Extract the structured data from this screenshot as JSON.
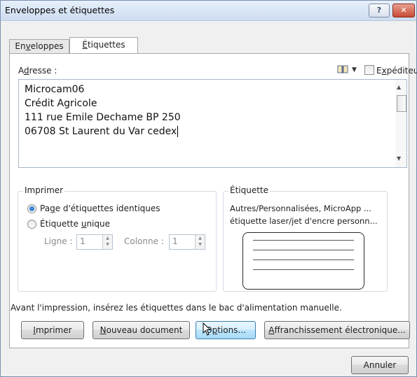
{
  "window": {
    "title": "Enveloppes et étiquettes",
    "help_glyph": "?",
    "close_glyph": "✕"
  },
  "tabs": [
    {
      "label_pre": "En",
      "label_u": "v",
      "label_post": "eloppes"
    },
    {
      "label_pre": "",
      "label_u": "É",
      "label_post": "tiquettes"
    }
  ],
  "address": {
    "label_pre": "A",
    "label_u": "d",
    "label_post": "resse :",
    "lines": [
      "Microcam06",
      "Crédit Agricole",
      "111 rue Emile Dechame BP 250",
      "06708 St Laurent du Var cedex"
    ],
    "sender_checkbox_pre": "E",
    "sender_checkbox_u": "x",
    "sender_checkbox_post": "péditeur",
    "sender_checked": false
  },
  "print_group": {
    "title": "Imprimer",
    "option1_pre": "Pa",
    "option1_u": "g",
    "option1_post": "e d'étiquettes identiques",
    "option2_pre": "Étiquette ",
    "option2_u": "u",
    "option2_post": "nique",
    "selected": "page",
    "row_label": "Ligne :",
    "row_value": "1",
    "col_label": "Colonne :",
    "col_value": "1"
  },
  "label_group": {
    "title": "Étiquette",
    "line1": "Autres/Personnalisées, MicroApp ...",
    "line2": "étiquette laser/jet d'encre personn..."
  },
  "instruction": "Avant l'impression, insérez les étiquettes dans le bac d'alimentation manuelle.",
  "buttons": {
    "print_pre": "",
    "print_u": "I",
    "print_post": "mprimer",
    "new_doc_pre": "",
    "new_doc_u": "N",
    "new_doc_post": "ouveau document",
    "options_pre": "O",
    "options_u": "p",
    "options_post": "tions...",
    "postage_pre": "",
    "postage_u": "A",
    "postage_post": "ffranchissement électronique...",
    "cancel": "Annuler"
  }
}
